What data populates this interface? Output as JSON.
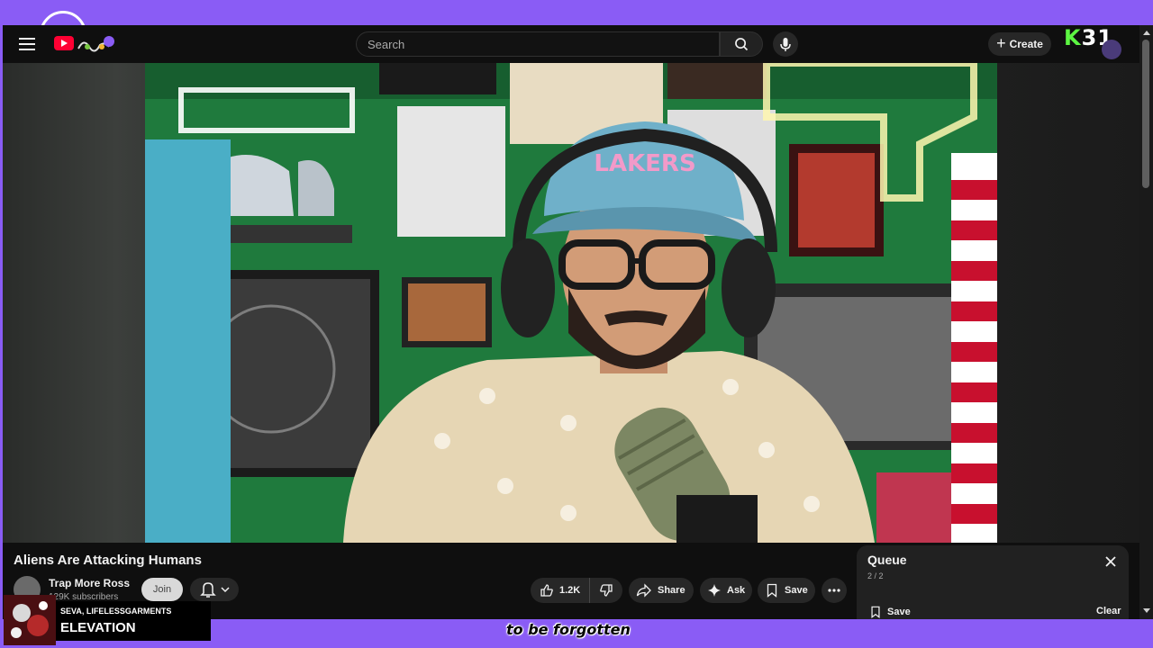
{
  "search": {
    "placeholder": "Search"
  },
  "header": {
    "create_label": "Create",
    "badge_letter": "K",
    "badge_number": "31"
  },
  "video": {
    "title": "Aliens Are Attacking Humans",
    "channel_name": "Trap More Ross",
    "subscribers": "129K subscribers",
    "join_label": "Join",
    "likes": "1.2K",
    "share_label": "Share",
    "ask_label": "Ask",
    "save_label": "Save",
    "cap_text": "LAKERS"
  },
  "queue": {
    "title": "Queue",
    "count": "2 / 2",
    "save_label": "Save",
    "clear_label": "Clear"
  },
  "now_playing": {
    "artist": "SEVA, LIFELESSGARMENTS",
    "song": "ELEVATION"
  },
  "caption": "to be forgotten",
  "colors": {
    "frame": "#8a5cf5",
    "background": "#0f0f0f",
    "brand": "#ff0033",
    "badge_green": "#5cf542"
  }
}
